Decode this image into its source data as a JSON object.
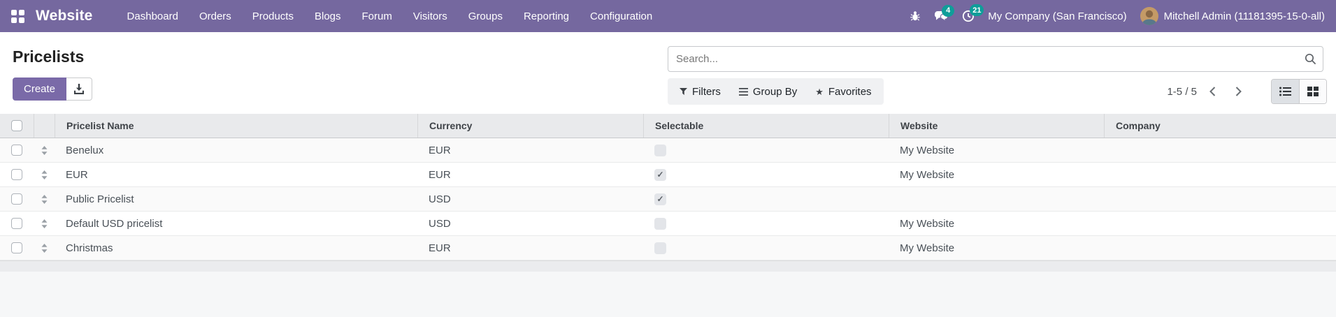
{
  "colors": {
    "navbar_bg": "#75689f",
    "badge": "#0f9d99",
    "primary_button": "#7a6aa8",
    "table_header_bg": "#e9eaec",
    "row_stripe": "#fafafa",
    "footer_strip": "#ebecee",
    "page_bottom": "#f6f7f8"
  },
  "navbar": {
    "brand": "Website",
    "menu_items": [
      "Dashboard",
      "Orders",
      "Products",
      "Blogs",
      "Forum",
      "Visitors",
      "Groups",
      "Reporting",
      "Configuration"
    ],
    "messages_badge": "4",
    "activities_badge": "21",
    "company": "My Company (San Francisco)",
    "user": "Mitchell Admin (11181395-15-0-all)"
  },
  "control_panel": {
    "title": "Pricelists",
    "create_label": "Create",
    "search_placeholder": "Search...",
    "filters_label": "Filters",
    "group_by_label": "Group By",
    "favorites_label": "Favorites",
    "pager_text": "1-5 / 5"
  },
  "table": {
    "columns": [
      "Pricelist Name",
      "Currency",
      "Selectable",
      "Website",
      "Company"
    ],
    "rows": [
      {
        "name": "Benelux",
        "currency": "EUR",
        "selectable": false,
        "website": "My Website",
        "company": ""
      },
      {
        "name": "EUR",
        "currency": "EUR",
        "selectable": true,
        "website": "My Website",
        "company": ""
      },
      {
        "name": "Public Pricelist",
        "currency": "USD",
        "selectable": true,
        "website": "",
        "company": ""
      },
      {
        "name": "Default USD pricelist",
        "currency": "USD",
        "selectable": false,
        "website": "My Website",
        "company": ""
      },
      {
        "name": "Christmas",
        "currency": "EUR",
        "selectable": false,
        "website": "My Website",
        "company": ""
      }
    ]
  }
}
